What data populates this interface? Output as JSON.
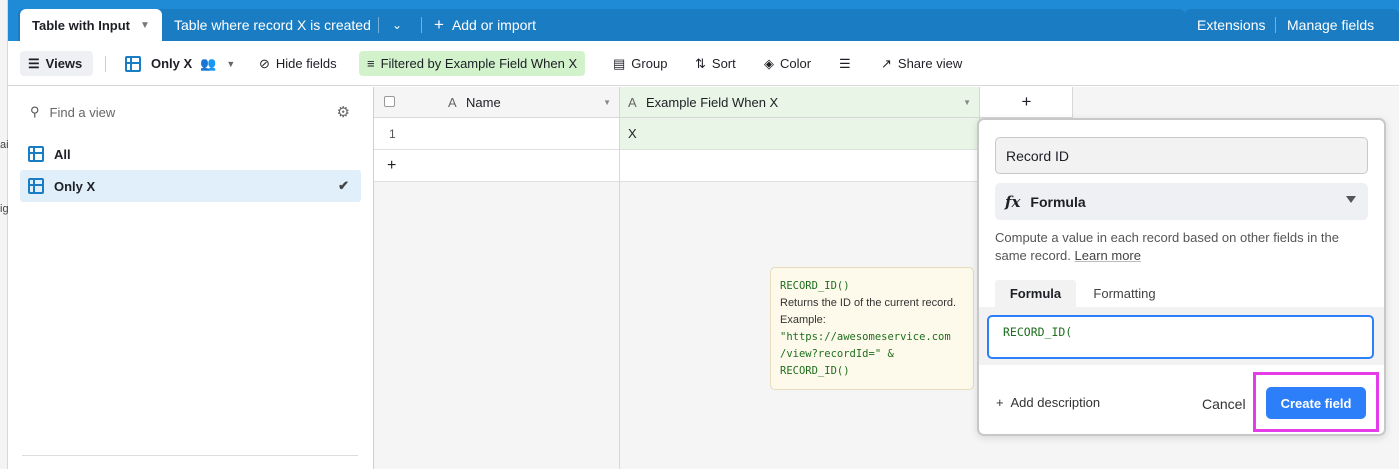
{
  "left_edge": {
    "fragments": [
      "ai",
      "ig"
    ]
  },
  "tabs": {
    "active": "Table with Input",
    "other": "Table where record X is created",
    "add_label": "Add or import"
  },
  "right_actions": {
    "extensions": "Extensions",
    "manage_fields": "Manage fields"
  },
  "toolbar": {
    "views": "Views",
    "view_name": "Only X",
    "hide_fields": "Hide fields",
    "filter": "Filtered by Example Field When X",
    "group": "Group",
    "sort": "Sort",
    "color": "Color",
    "share": "Share view"
  },
  "sidebar": {
    "search_placeholder": "Find a view",
    "views": [
      {
        "name": "All",
        "selected": false
      },
      {
        "name": "Only X",
        "selected": true
      }
    ]
  },
  "grid": {
    "columns": [
      "Name",
      "Example Field When X"
    ],
    "rows": [
      {
        "num": "1",
        "name": "",
        "example": "X"
      }
    ],
    "add_row": "+",
    "add_column": "+"
  },
  "tooltip": {
    "function_sig": "RECORD_ID()",
    "description": "Returns the ID of the current record. Example:",
    "example_line1": "\"https://awesomeservice.com",
    "example_line2": "/view?recordId=\" &",
    "example_line3": "RECORD_ID()"
  },
  "popup": {
    "field_name": "Record ID",
    "field_type": "Formula",
    "description": "Compute a value in each record based on other fields in the same record.",
    "learn_more": "Learn more",
    "tab_formula": "Formula",
    "tab_formatting": "Formatting",
    "formula_value": "RECORD_ID(",
    "add_description": "Add description",
    "cancel": "Cancel",
    "create": "Create field"
  },
  "colors": {
    "accent": "#2d7ff9",
    "tab_bar": "#1f8ad6",
    "filter_bg": "#d1f2cb",
    "highlight": "#e53be8"
  }
}
